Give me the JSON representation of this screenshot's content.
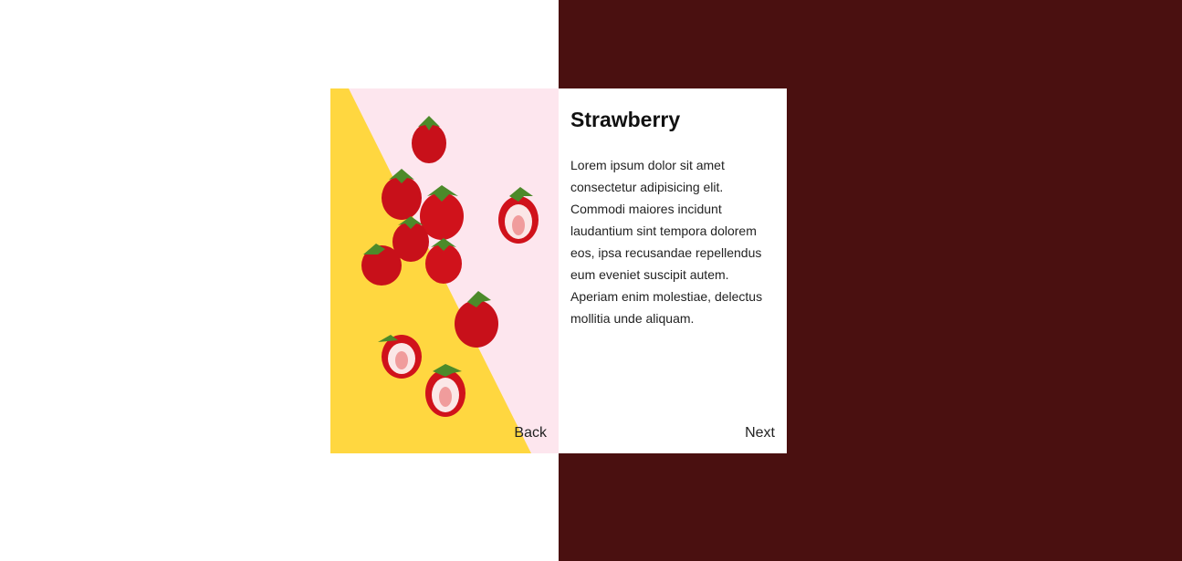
{
  "card": {
    "title": "Strawberry",
    "description": "Lorem ipsum dolor sit amet consectetur adipisicing elit. Commodi maiores incidunt laudantium sint tempora dolorem eos, ipsa recusandae repellendus eum eveniet suscipit autem. Aperiam enim molestiae, delectus mollitia unde aliquam.",
    "back_label": "Back",
    "next_label": "Next",
    "image_icon": "strawberries-photo"
  },
  "colors": {
    "left_background": "#ffffff",
    "right_background": "#4a1010",
    "image_yellow": "#ffd740",
    "image_pink": "#fde6ee",
    "strawberry_red": "#d0121b"
  }
}
